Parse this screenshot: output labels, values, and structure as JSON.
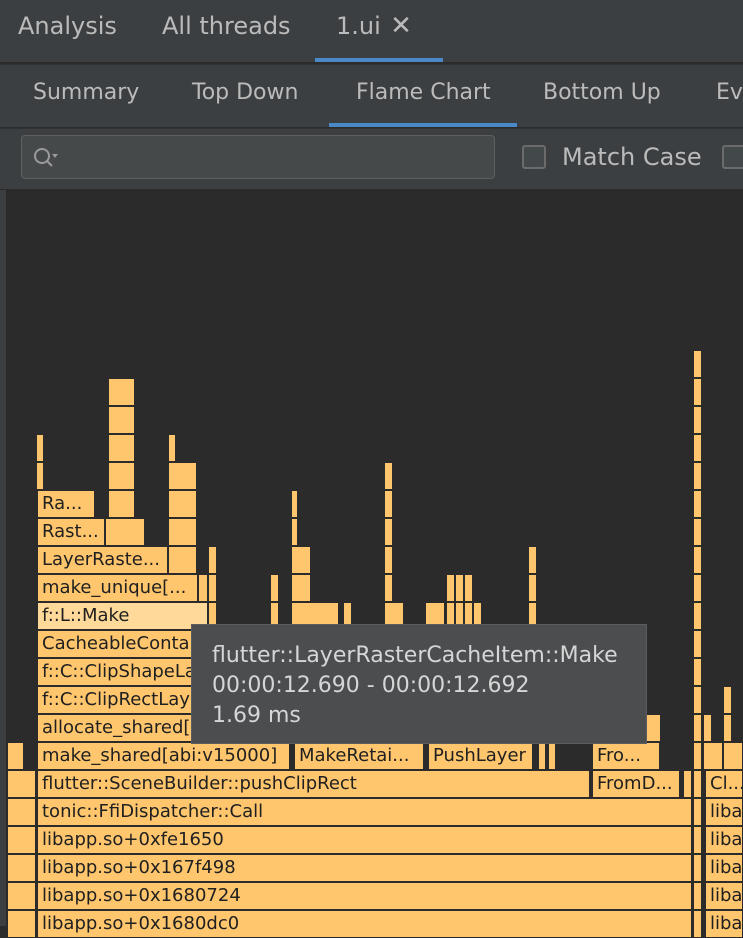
{
  "top_tabs": [
    {
      "label": "Analysis"
    },
    {
      "label": "All threads"
    },
    {
      "label": "1.ui",
      "active": true
    }
  ],
  "view_tabs": [
    {
      "label": "Summary"
    },
    {
      "label": "Top Down"
    },
    {
      "label": "Flame Chart",
      "active": true
    },
    {
      "label": "Bottom Up"
    },
    {
      "label": "Ev"
    }
  ],
  "search": {
    "placeholder": "",
    "value": ""
  },
  "filters": {
    "match_case_label": "Match Case",
    "match_case_checked": false
  },
  "flame": {
    "labels": {
      "ra": "Ra...",
      "rast": "Rast...",
      "layer_raste": "LayerRaste...",
      "make_unique": "make_unique[...",
      "flmake": "f::L::Make",
      "cacheable": "CacheableContai",
      "clipshape": "f::C::ClipShapeLa",
      "cliprect": "f::C::ClipRectLay",
      "allocate_shared": "allocate_shared[",
      "make_shared": "make_shared[abi:v15000]",
      "makeretai": "MakeRetai...",
      "pushlayer": "PushLayer",
      "fro": "Fro...",
      "pushcliprect": "flutter::SceneBuilder::pushClipRect",
      "fromd": "FromD...",
      "cl": "Cl...",
      "ffi": "tonic::FfiDispatcher::Call",
      "liba1": "liba",
      "lib1": "libapp.so+0xfe1650",
      "liba2": "liba",
      "lib2": "libapp.so+0x167f498",
      "liba3": "liba",
      "lib3": "libapp.so+0x1680724",
      "liba4": "liba",
      "lib4": "libapp.so+0x1680dc0",
      "liba5": "liba"
    }
  },
  "tooltip": {
    "name": "flutter::LayerRasterCacheItem::Make",
    "range": "00:00:12.690 - 00:00:12.692",
    "duration": "1.69 ms"
  },
  "colors": {
    "frame": "#ffc66d",
    "accent": "#4a88c7",
    "background": "#2b2b2b"
  }
}
